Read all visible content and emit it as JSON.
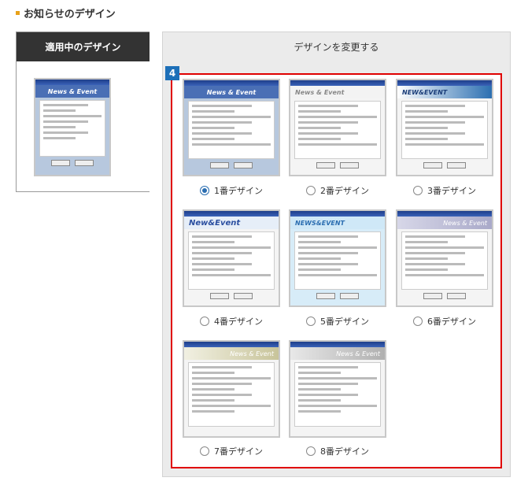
{
  "section": {
    "title": "お知らせのデザイン"
  },
  "current": {
    "title": "適用中のデザイン",
    "thumb_header": "News & Event"
  },
  "change": {
    "title": "デザインを変更する",
    "step": "4"
  },
  "options": [
    {
      "label": "1番デザイン",
      "selected": true,
      "thumb_header": "News & Event"
    },
    {
      "label": "2番デザイン",
      "selected": false,
      "thumb_header": "News & Event"
    },
    {
      "label": "3番デザイン",
      "selected": false,
      "thumb_header": "NEW&EVENT"
    },
    {
      "label": "4番デザイン",
      "selected": false,
      "thumb_header": "New&Event"
    },
    {
      "label": "5番デザイン",
      "selected": false,
      "thumb_header": "NEWS&EVENT"
    },
    {
      "label": "6番デザイン",
      "selected": false,
      "thumb_header": "News & Event"
    },
    {
      "label": "7番デザイン",
      "selected": false,
      "thumb_header": "News & Event"
    },
    {
      "label": "8番デザイン",
      "selected": false,
      "thumb_header": "News & Event"
    }
  ]
}
